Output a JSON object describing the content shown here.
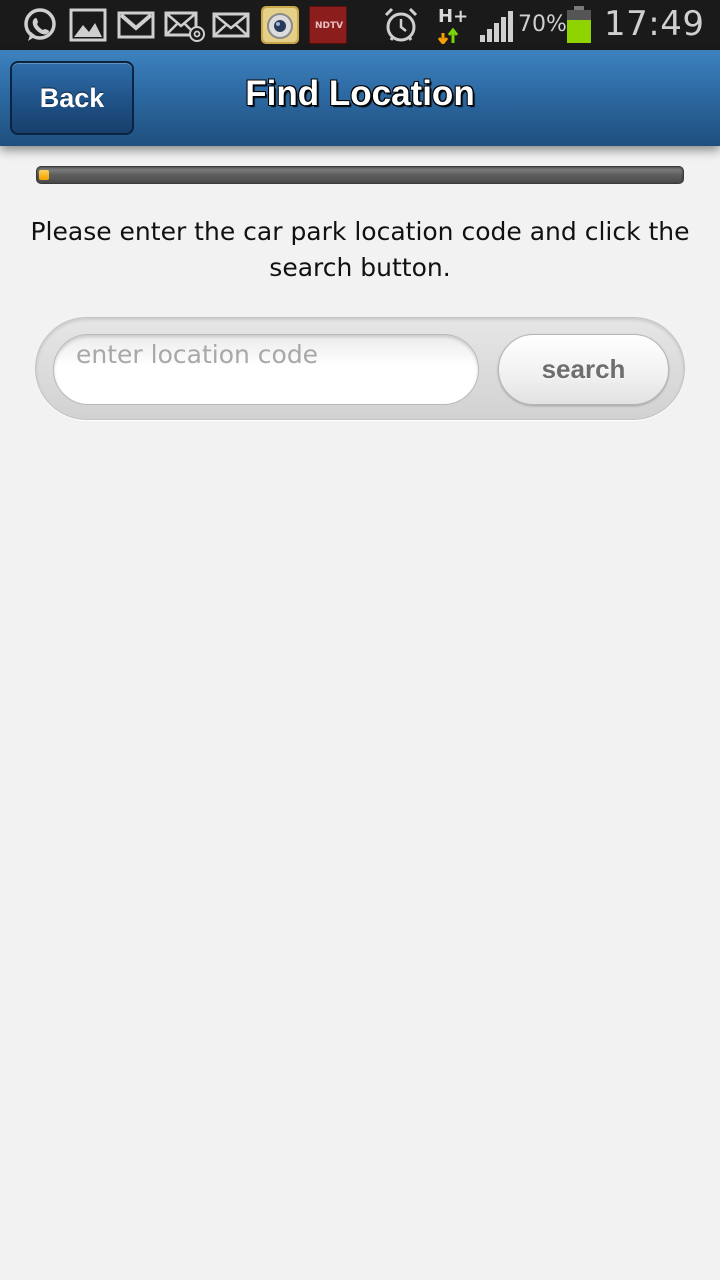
{
  "status_bar": {
    "notification_icons": [
      "whatsapp-icon",
      "gallery-icon",
      "gmail-icon",
      "email-icon",
      "mail-icon",
      "camera-app-icon",
      "ndtv-icon"
    ],
    "ndtv_label": "NDTV",
    "network_label": "H+",
    "battery_percent": "70%",
    "battery_level": 0.7,
    "time": "17:49",
    "colors": {
      "battery": "#8fd400",
      "network_up": "#7cd40a",
      "network_down": "#f5a000"
    }
  },
  "header": {
    "back_label": "Back",
    "title": "Find Location",
    "colors": {
      "gradient_top": "#3d82bf",
      "gradient_bottom": "#1f4f7e"
    }
  },
  "progress": {
    "value": 0.015
  },
  "instructions": "Please enter the car park location code and click the search button.",
  "search": {
    "placeholder": "enter location code",
    "value": "",
    "button_label": "search"
  }
}
